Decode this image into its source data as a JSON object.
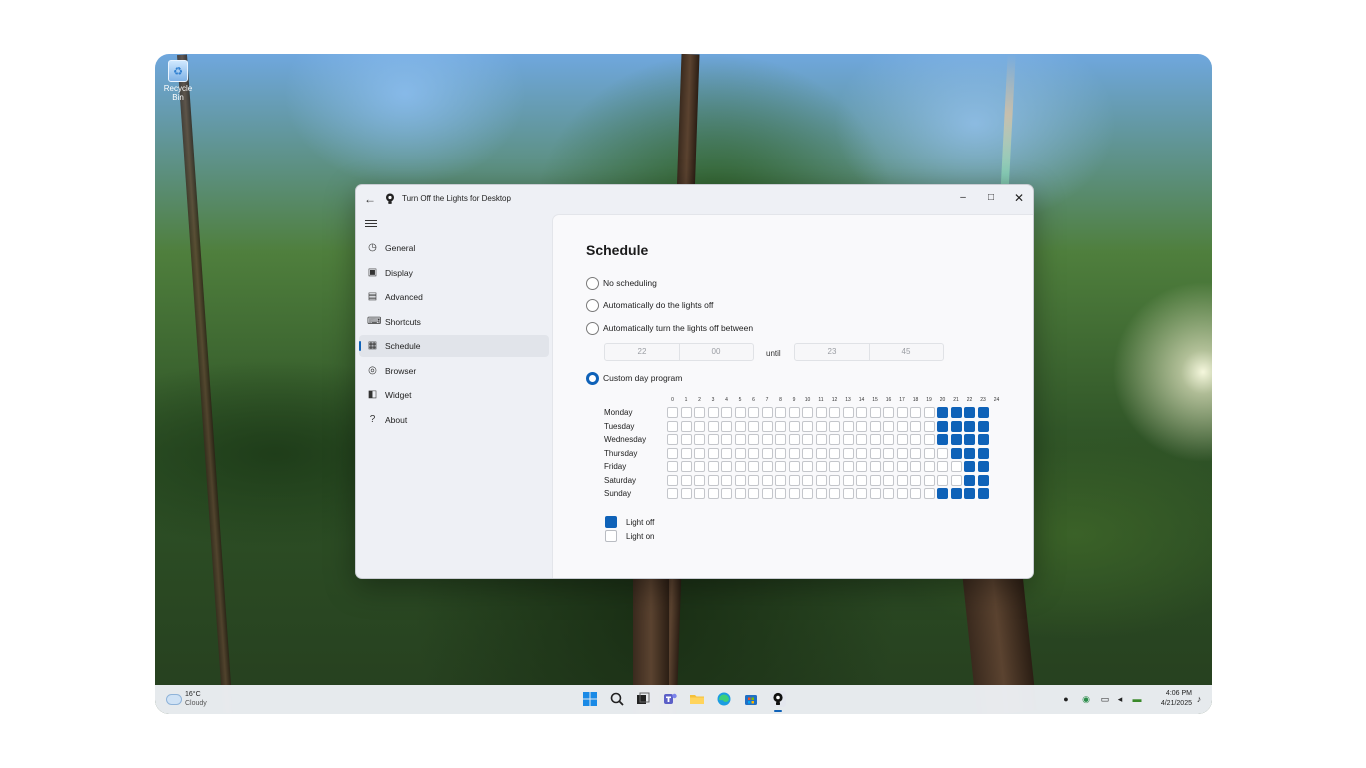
{
  "desktop": {
    "recycle_bin_label": "Recycle Bin"
  },
  "window": {
    "title": "Turn Off the Lights for Desktop",
    "controls": {
      "minimize": "–",
      "maximize": "□",
      "close": "✕"
    }
  },
  "sidebar": {
    "items": [
      {
        "label": "General",
        "icon": "general-icon"
      },
      {
        "label": "Display",
        "icon": "display-icon"
      },
      {
        "label": "Advanced",
        "icon": "advanced-icon"
      },
      {
        "label": "Shortcuts",
        "icon": "shortcuts-icon"
      },
      {
        "label": "Schedule",
        "icon": "schedule-icon",
        "selected": true
      },
      {
        "label": "Browser",
        "icon": "browser-icon"
      },
      {
        "label": "Widget",
        "icon": "widget-icon"
      },
      {
        "label": "About",
        "icon": "about-icon"
      }
    ]
  },
  "schedule": {
    "title": "Schedule",
    "options": [
      {
        "label": "No scheduling",
        "checked": false
      },
      {
        "label": "Automatically do the lights off",
        "checked": false
      },
      {
        "label": "Automatically turn the lights off between",
        "checked": false
      },
      {
        "label": "Custom day program",
        "checked": true
      }
    ],
    "time_from": {
      "hour": "22",
      "minute": "00"
    },
    "until_label": "until",
    "time_to": {
      "hour": "23",
      "minute": "45"
    },
    "hours": [
      "0",
      "1",
      "2",
      "3",
      "4",
      "5",
      "6",
      "7",
      "8",
      "9",
      "10",
      "11",
      "12",
      "13",
      "14",
      "15",
      "16",
      "17",
      "18",
      "19",
      "20",
      "21",
      "22",
      "23",
      "24"
    ],
    "days": [
      {
        "name": "Monday",
        "off_hours": [
          20,
          21,
          22,
          23
        ]
      },
      {
        "name": "Tuesday",
        "off_hours": [
          20,
          21,
          22,
          23
        ]
      },
      {
        "name": "Wednesday",
        "off_hours": [
          20,
          21,
          22,
          23
        ]
      },
      {
        "name": "Thursday",
        "off_hours": [
          21,
          22,
          23
        ]
      },
      {
        "name": "Friday",
        "off_hours": [
          22,
          23
        ]
      },
      {
        "name": "Saturday",
        "off_hours": [
          22,
          23
        ]
      },
      {
        "name": "Sunday",
        "off_hours": [
          20,
          21,
          22,
          23
        ]
      }
    ],
    "legend": {
      "off": "Light off",
      "on": "Light on"
    },
    "accent_color": "#0f62b8"
  },
  "taskbar": {
    "weather": {
      "temp": "16°C",
      "condition": "Cloudy"
    },
    "apps": [
      "start-icon",
      "search-icon",
      "task-view-icon",
      "teams-icon",
      "file-explorer-icon",
      "edge-icon",
      "store-icon",
      "turn-off-the-lights-icon"
    ],
    "clock": {
      "time": "4:06 PM",
      "date": "4/21/2025"
    }
  }
}
